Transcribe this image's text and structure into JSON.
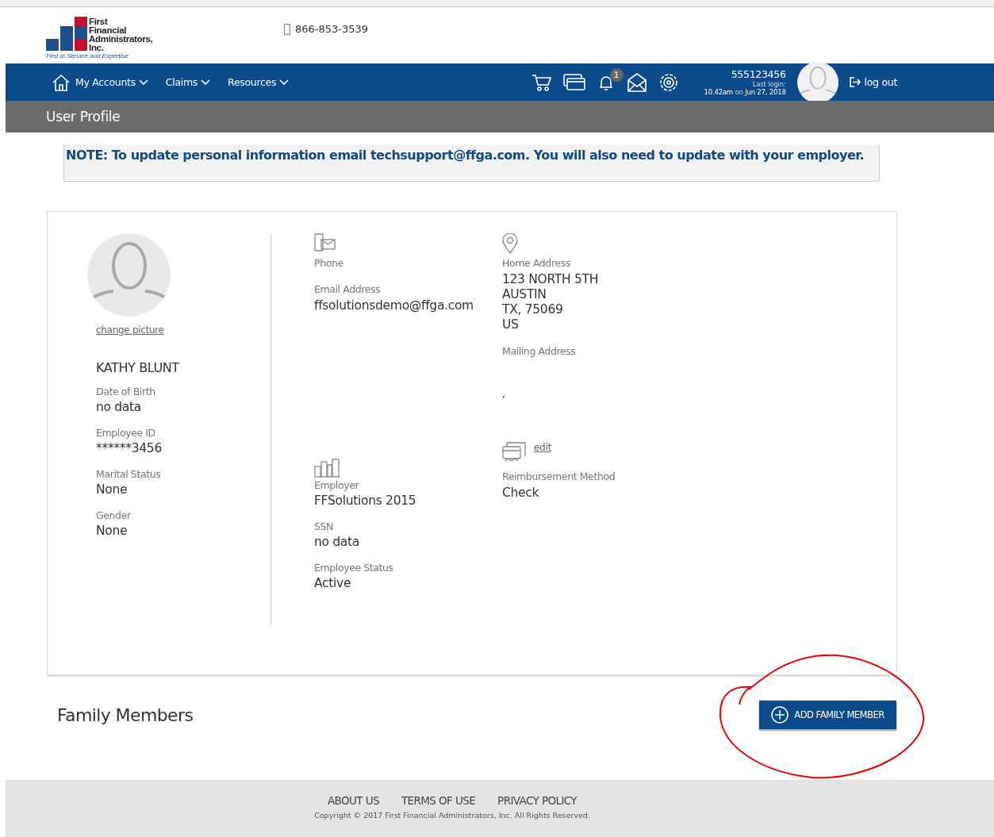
{
  "header": {
    "logo_lines": [
      "First",
      "Financial",
      "Administrators,",
      "Inc."
    ],
    "tagline": "First in Service and Expertise",
    "phone": "866-853-3539"
  },
  "nav": {
    "items": [
      {
        "label": "My Accounts"
      },
      {
        "label": "Claims"
      },
      {
        "label": "Resources"
      }
    ],
    "notification_count": "1",
    "account_number": "555123456",
    "last_login_label": "Last login:",
    "last_login": "**10.42am** on **Jun 27, 2018**",
    "logout": "log out"
  },
  "page_title": "User Profile",
  "note": "NOTE: To update personal information email techsupport@ffga.com. You will also need to update with your employer.",
  "profile": {
    "change_picture": "change picture",
    "name": "KATHY BLUNT",
    "left_fields": [
      {
        "label": "Date of Birth",
        "value": "no data"
      },
      {
        "label": "Employee ID",
        "value": "******3456"
      },
      {
        "label": "Marital Status",
        "value": "None"
      },
      {
        "label": "Gender",
        "value": "None"
      }
    ],
    "phone_label": "Phone",
    "email_label": "Email Address",
    "email": "ffsolutionsdemo@ffga.com",
    "home_label": "Home Address",
    "home_lines": [
      "123 NORTH 5TH",
      "AUSTIN",
      "TX, 75069",
      "US"
    ],
    "mailing_label": "Mailing Address",
    "mailing_value": ",",
    "employer_fields": [
      {
        "label": "Employer",
        "value": "FFSolutions 2015"
      },
      {
        "label": "SSN",
        "value": "no data"
      },
      {
        "label": "Employee Status",
        "value": "Active"
      }
    ],
    "edit": "edit",
    "reimbursement_label": "Reimbursement Method",
    "reimbursement": "Check"
  },
  "family": {
    "title": "Family Members",
    "button": "ADD FAMILY MEMBER"
  },
  "footer": {
    "links": [
      "ABOUT US",
      "TERMS OF USE",
      "PRIVACY POLICY"
    ],
    "copyright": "Copyright © 2017 First Financial Administrators, Inc. All Rights Reserved."
  }
}
